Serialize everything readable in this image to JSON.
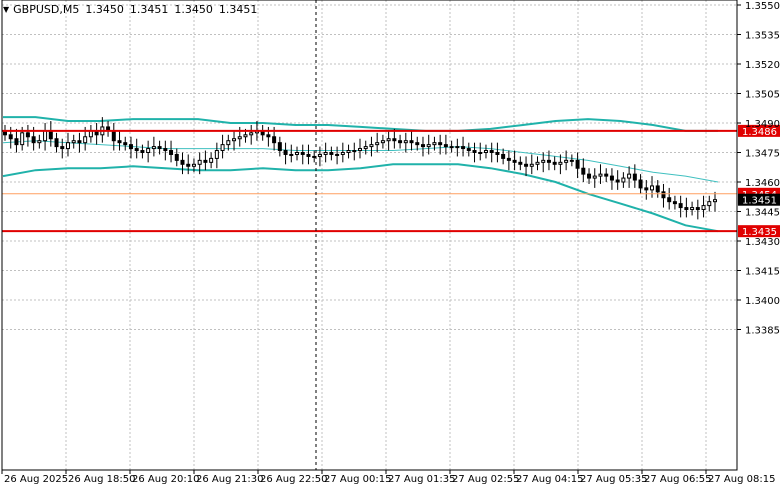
{
  "header": {
    "symbol": "GBPUSD,M5",
    "open": "1.3450",
    "high": "1.3451",
    "low": "1.3450",
    "close": "1.3451"
  },
  "colors": {
    "background": "#ffffff",
    "grid": "#c0c0c0",
    "candle": "#000000",
    "bands": "#20b2aa",
    "ma": "#40c0c0",
    "level_line": "#e00000",
    "orange_line": "#ff9f60",
    "price_tag": "#000000",
    "level_tag": "#e00000"
  },
  "chart_data": {
    "type": "candlestick",
    "y_ticks": [
      "1.3550",
      "1.3535",
      "1.3520",
      "1.3505",
      "1.3490",
      "1.3475",
      "1.3460",
      "1.3445",
      "1.3430",
      "1.3415",
      "1.3400",
      "1.3385"
    ],
    "ylim": [
      1.338,
      1.3552
    ],
    "x_labels": [
      "26 Aug 2025",
      "26 Aug 18:50",
      "26 Aug 20:10",
      "26 Aug 21:30",
      "26 Aug 22:50",
      "27 Aug 00:15",
      "27 Aug 01:35",
      "27 Aug 02:55",
      "27 Aug 04:15",
      "27 Aug 05:35",
      "27 Aug 06:55",
      "27 Aug 08:15"
    ],
    "horizontal_levels": [
      {
        "label": "1.3486",
        "value": 1.3486,
        "role": "resistance"
      },
      {
        "label": "1.3454",
        "value": 1.3454,
        "role": "orange"
      },
      {
        "label": "1.3435",
        "value": 1.3435,
        "role": "support"
      }
    ],
    "current_price": {
      "label": "1.3451",
      "value": 1.3451
    },
    "candle_closes": [
      1.3484,
      1.3482,
      1.3479,
      1.3485,
      1.3483,
      1.348,
      1.3481,
      1.3486,
      1.3482,
      1.3478,
      1.3477,
      1.348,
      1.3481,
      1.348,
      1.3483,
      1.3486,
      1.3484,
      1.3488,
      1.3486,
      1.3481,
      1.348,
      1.3479,
      1.3477,
      1.3476,
      1.3475,
      1.3477,
      1.3478,
      1.3477,
      1.3476,
      1.3474,
      1.3471,
      1.3469,
      1.3468,
      1.3469,
      1.3471,
      1.347,
      1.3472,
      1.3476,
      1.3479,
      1.3481,
      1.3482,
      1.3483,
      1.3484,
      1.3485,
      1.3486,
      1.3484,
      1.3483,
      1.348,
      1.3476,
      1.3474,
      1.3474,
      1.3475,
      1.3474,
      1.3473,
      1.3473,
      1.3474,
      1.3475,
      1.3474,
      1.3474,
      1.3475,
      1.3476,
      1.3476,
      1.3477,
      1.3478,
      1.3479,
      1.348,
      1.3481,
      1.3482,
      1.3481,
      1.348,
      1.3481,
      1.348,
      1.3479,
      1.3478,
      1.3479,
      1.348,
      1.3479,
      1.3478,
      1.3478,
      1.3478,
      1.3477,
      1.3476,
      1.3475,
      1.3475,
      1.3476,
      1.3475,
      1.3474,
      1.3472,
      1.3471,
      1.347,
      1.3469,
      1.3468,
      1.3469,
      1.347,
      1.3471,
      1.347,
      1.3469,
      1.347,
      1.3471,
      1.3471,
      1.3467,
      1.3464,
      1.3462,
      1.3463,
      1.3464,
      1.3463,
      1.3461,
      1.346,
      1.3462,
      1.3464,
      1.3461,
      1.3457,
      1.3456,
      1.3458,
      1.3455,
      1.3452,
      1.345,
      1.3449,
      1.3447,
      1.3446,
      1.3447,
      1.3446,
      1.3448,
      1.345,
      1.3451
    ],
    "bb_upper": [
      1.3493,
      1.3493,
      1.3491,
      1.3491,
      1.3492,
      1.3492,
      1.3492,
      1.349,
      1.349,
      1.3489,
      1.3489,
      1.3488,
      1.3487,
      1.3486,
      1.3486,
      1.3487,
      1.3489,
      1.3491,
      1.3492,
      1.3491,
      1.3489,
      1.3486,
      1.3486
    ],
    "bb_lower": [
      1.3463,
      1.3466,
      1.3467,
      1.3467,
      1.3468,
      1.3467,
      1.3466,
      1.3466,
      1.3467,
      1.3466,
      1.3466,
      1.3467,
      1.3469,
      1.3469,
      1.3469,
      1.3467,
      1.3464,
      1.346,
      1.3454,
      1.3449,
      1.3444,
      1.3438,
      1.3435
    ],
    "ma_values": [
      1.348,
      1.3481,
      1.348,
      1.3479,
      1.3478,
      1.3477,
      1.3477,
      1.3477,
      1.3477,
      1.3476,
      1.3476,
      1.3476,
      1.3476,
      1.3477,
      1.3478,
      1.3477,
      1.3475,
      1.3473,
      1.3471,
      1.3468,
      1.3465,
      1.3463,
      1.346
    ]
  }
}
